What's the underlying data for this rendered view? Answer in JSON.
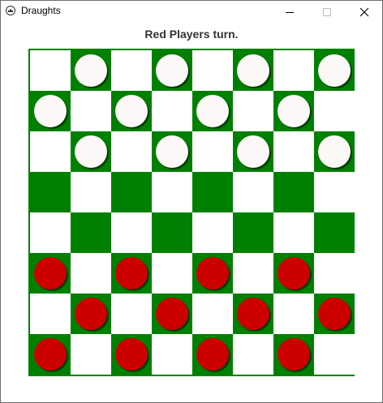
{
  "window": {
    "title": "Draughts",
    "app_icon": "crown-icon",
    "controls": [
      "minimize-icon",
      "maximize-icon",
      "close-icon"
    ]
  },
  "status": "Red Players turn.",
  "colors": {
    "dark_square": "#008000",
    "light_square": "#ffffff",
    "red_piece": "#cc0000",
    "white_piece": "#fdf8f8"
  },
  "board": {
    "rows": 8,
    "cols": 8,
    "layout": [
      ".w.w.w.w",
      "w.w.w.w.",
      ".w.w.w.w",
      "........",
      "........",
      "r.r.r.r.",
      ".r.r.r.r",
      "r.r.r.r."
    ]
  }
}
